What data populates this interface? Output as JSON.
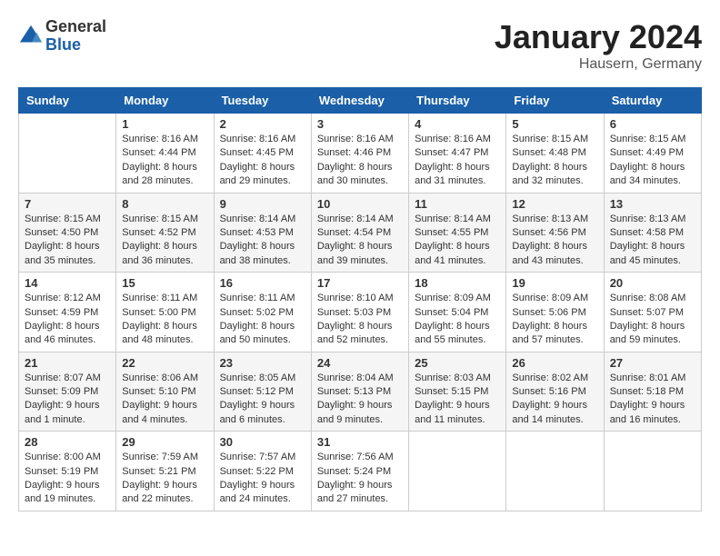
{
  "logo": {
    "general": "General",
    "blue": "Blue"
  },
  "header": {
    "month": "January 2024",
    "location": "Hausern, Germany"
  },
  "weekdays": [
    "Sunday",
    "Monday",
    "Tuesday",
    "Wednesday",
    "Thursday",
    "Friday",
    "Saturday"
  ],
  "weeks": [
    [
      {
        "day": "",
        "sunrise": "",
        "sunset": "",
        "daylight": ""
      },
      {
        "day": "1",
        "sunrise": "Sunrise: 8:16 AM",
        "sunset": "Sunset: 4:44 PM",
        "daylight": "Daylight: 8 hours and 28 minutes."
      },
      {
        "day": "2",
        "sunrise": "Sunrise: 8:16 AM",
        "sunset": "Sunset: 4:45 PM",
        "daylight": "Daylight: 8 hours and 29 minutes."
      },
      {
        "day": "3",
        "sunrise": "Sunrise: 8:16 AM",
        "sunset": "Sunset: 4:46 PM",
        "daylight": "Daylight: 8 hours and 30 minutes."
      },
      {
        "day": "4",
        "sunrise": "Sunrise: 8:16 AM",
        "sunset": "Sunset: 4:47 PM",
        "daylight": "Daylight: 8 hours and 31 minutes."
      },
      {
        "day": "5",
        "sunrise": "Sunrise: 8:15 AM",
        "sunset": "Sunset: 4:48 PM",
        "daylight": "Daylight: 8 hours and 32 minutes."
      },
      {
        "day": "6",
        "sunrise": "Sunrise: 8:15 AM",
        "sunset": "Sunset: 4:49 PM",
        "daylight": "Daylight: 8 hours and 34 minutes."
      }
    ],
    [
      {
        "day": "7",
        "sunrise": "Sunrise: 8:15 AM",
        "sunset": "Sunset: 4:50 PM",
        "daylight": "Daylight: 8 hours and 35 minutes."
      },
      {
        "day": "8",
        "sunrise": "Sunrise: 8:15 AM",
        "sunset": "Sunset: 4:52 PM",
        "daylight": "Daylight: 8 hours and 36 minutes."
      },
      {
        "day": "9",
        "sunrise": "Sunrise: 8:14 AM",
        "sunset": "Sunset: 4:53 PM",
        "daylight": "Daylight: 8 hours and 38 minutes."
      },
      {
        "day": "10",
        "sunrise": "Sunrise: 8:14 AM",
        "sunset": "Sunset: 4:54 PM",
        "daylight": "Daylight: 8 hours and 39 minutes."
      },
      {
        "day": "11",
        "sunrise": "Sunrise: 8:14 AM",
        "sunset": "Sunset: 4:55 PM",
        "daylight": "Daylight: 8 hours and 41 minutes."
      },
      {
        "day": "12",
        "sunrise": "Sunrise: 8:13 AM",
        "sunset": "Sunset: 4:56 PM",
        "daylight": "Daylight: 8 hours and 43 minutes."
      },
      {
        "day": "13",
        "sunrise": "Sunrise: 8:13 AM",
        "sunset": "Sunset: 4:58 PM",
        "daylight": "Daylight: 8 hours and 45 minutes."
      }
    ],
    [
      {
        "day": "14",
        "sunrise": "Sunrise: 8:12 AM",
        "sunset": "Sunset: 4:59 PM",
        "daylight": "Daylight: 8 hours and 46 minutes."
      },
      {
        "day": "15",
        "sunrise": "Sunrise: 8:11 AM",
        "sunset": "Sunset: 5:00 PM",
        "daylight": "Daylight: 8 hours and 48 minutes."
      },
      {
        "day": "16",
        "sunrise": "Sunrise: 8:11 AM",
        "sunset": "Sunset: 5:02 PM",
        "daylight": "Daylight: 8 hours and 50 minutes."
      },
      {
        "day": "17",
        "sunrise": "Sunrise: 8:10 AM",
        "sunset": "Sunset: 5:03 PM",
        "daylight": "Daylight: 8 hours and 52 minutes."
      },
      {
        "day": "18",
        "sunrise": "Sunrise: 8:09 AM",
        "sunset": "Sunset: 5:04 PM",
        "daylight": "Daylight: 8 hours and 55 minutes."
      },
      {
        "day": "19",
        "sunrise": "Sunrise: 8:09 AM",
        "sunset": "Sunset: 5:06 PM",
        "daylight": "Daylight: 8 hours and 57 minutes."
      },
      {
        "day": "20",
        "sunrise": "Sunrise: 8:08 AM",
        "sunset": "Sunset: 5:07 PM",
        "daylight": "Daylight: 8 hours and 59 minutes."
      }
    ],
    [
      {
        "day": "21",
        "sunrise": "Sunrise: 8:07 AM",
        "sunset": "Sunset: 5:09 PM",
        "daylight": "Daylight: 9 hours and 1 minute."
      },
      {
        "day": "22",
        "sunrise": "Sunrise: 8:06 AM",
        "sunset": "Sunset: 5:10 PM",
        "daylight": "Daylight: 9 hours and 4 minutes."
      },
      {
        "day": "23",
        "sunrise": "Sunrise: 8:05 AM",
        "sunset": "Sunset: 5:12 PM",
        "daylight": "Daylight: 9 hours and 6 minutes."
      },
      {
        "day": "24",
        "sunrise": "Sunrise: 8:04 AM",
        "sunset": "Sunset: 5:13 PM",
        "daylight": "Daylight: 9 hours and 9 minutes."
      },
      {
        "day": "25",
        "sunrise": "Sunrise: 8:03 AM",
        "sunset": "Sunset: 5:15 PM",
        "daylight": "Daylight: 9 hours and 11 minutes."
      },
      {
        "day": "26",
        "sunrise": "Sunrise: 8:02 AM",
        "sunset": "Sunset: 5:16 PM",
        "daylight": "Daylight: 9 hours and 14 minutes."
      },
      {
        "day": "27",
        "sunrise": "Sunrise: 8:01 AM",
        "sunset": "Sunset: 5:18 PM",
        "daylight": "Daylight: 9 hours and 16 minutes."
      }
    ],
    [
      {
        "day": "28",
        "sunrise": "Sunrise: 8:00 AM",
        "sunset": "Sunset: 5:19 PM",
        "daylight": "Daylight: 9 hours and 19 minutes."
      },
      {
        "day": "29",
        "sunrise": "Sunrise: 7:59 AM",
        "sunset": "Sunset: 5:21 PM",
        "daylight": "Daylight: 9 hours and 22 minutes."
      },
      {
        "day": "30",
        "sunrise": "Sunrise: 7:57 AM",
        "sunset": "Sunset: 5:22 PM",
        "daylight": "Daylight: 9 hours and 24 minutes."
      },
      {
        "day": "31",
        "sunrise": "Sunrise: 7:56 AM",
        "sunset": "Sunset: 5:24 PM",
        "daylight": "Daylight: 9 hours and 27 minutes."
      },
      {
        "day": "",
        "sunrise": "",
        "sunset": "",
        "daylight": ""
      },
      {
        "day": "",
        "sunrise": "",
        "sunset": "",
        "daylight": ""
      },
      {
        "day": "",
        "sunrise": "",
        "sunset": "",
        "daylight": ""
      }
    ]
  ]
}
